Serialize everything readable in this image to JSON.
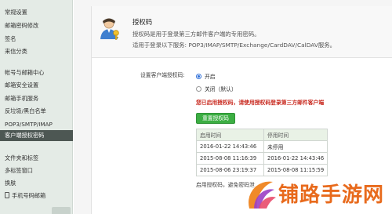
{
  "sidebar": {
    "items": [
      {
        "label": "常规设置"
      },
      {
        "label": "邮箱密码修改"
      },
      {
        "label": "签名"
      },
      {
        "label": "来信分类"
      },
      {
        "label": "帐号与邮箱中心"
      },
      {
        "label": "邮箱安全设置"
      },
      {
        "label": "邮箱手机服务"
      },
      {
        "label": "反垃圾/黑白名单"
      },
      {
        "label": "POP3/SMTP/IMAP"
      },
      {
        "label": "客户端授权密码"
      },
      {
        "label": "文件夹和标签"
      },
      {
        "label": "多标签窗口"
      },
      {
        "label": "换肤"
      },
      {
        "label": "手机号码邮箱"
      }
    ],
    "active_index": 9
  },
  "header": {
    "title": "授权码",
    "description": "授权码是用于登录第三方邮件客户端的专用密码。",
    "services": "适用于登录以下服务: POP3/IMAP/SMTP/Exchange/CardDAV/CalDAV服务。"
  },
  "settings": {
    "label": "设置客户端授权码:",
    "option_on": "开启",
    "option_off": "关闭（默认）",
    "selected": "开启",
    "notice": "您已启用授权码，请使用授权码登录第三方邮件客户端",
    "reset_button": "重置授权码"
  },
  "table": {
    "headers": [
      "启用时间",
      "停用时间"
    ],
    "rows": [
      [
        "2016-01-22 14:43:46",
        "未停用"
      ],
      [
        "2015-08-08 11:16:39",
        "2016-01-22 14:43:46"
      ],
      [
        "2015-08-06 23:19:37",
        "2015-08-08 11:15:59"
      ]
    ]
  },
  "footnote": "启用授权码，避免密码泄",
  "watermark": {
    "text": "铺路手游网",
    "color": "#e86a1c"
  },
  "colors": {
    "accent_green": "#3cae43",
    "notice_red": "#c8281e",
    "sidebar_active": "#4d5753",
    "radio_blue": "#2e6fd8"
  }
}
